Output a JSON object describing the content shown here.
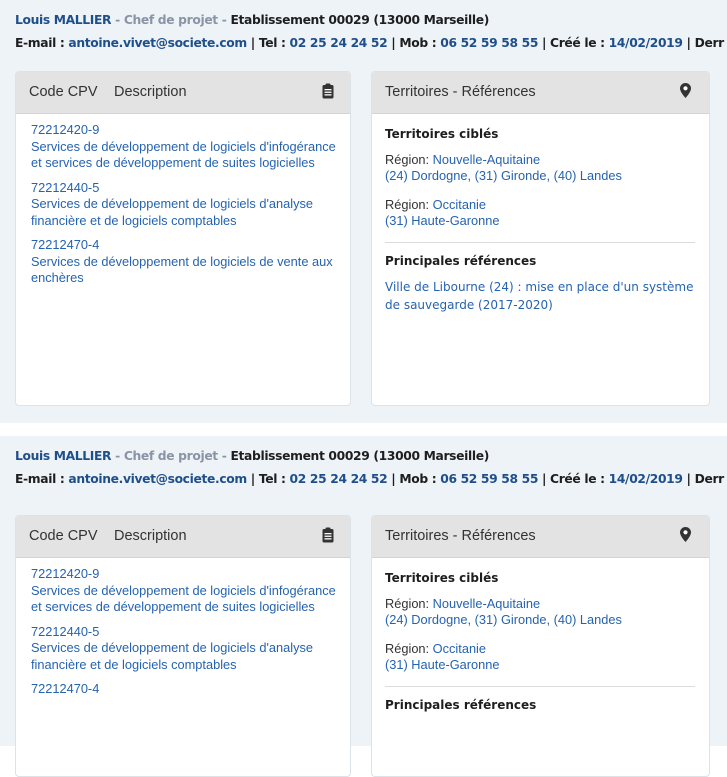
{
  "blocks": [
    {
      "contact": {
        "name": "Louis MALLIER",
        "role": "Chef de projet",
        "etablissement": "Etablissement 00029 (13000 Marseille)",
        "email_label": "E-mail :",
        "email": "antoine.vivet@societe.com",
        "tel_label": "Tel :",
        "tel": "02 25 24 24 52",
        "mob_label": "Mob :",
        "mob": "06 52 59 58 55",
        "cree_label": "Créé le :",
        "cree": "14/02/2019",
        "trailing": "Derr"
      },
      "cpv_card": {
        "col1": "Code CPV",
        "col2": "Description",
        "items": [
          {
            "code": "72212420-9",
            "desc": "Services de développement de logiciels d'infogérance et services de développement de suites logicielles"
          },
          {
            "code": "72212440-5",
            "desc": "Services de développement de logiciels d'analyse financière et de logiciels comptables"
          },
          {
            "code": "72212470-4",
            "desc": "Services de développement de logiciels de vente aux enchères"
          }
        ]
      },
      "terr_card": {
        "title": "Territoires - Références",
        "targeted_title": "Territoires ciblés",
        "regions": [
          {
            "label": "Région:",
            "name": "Nouvelle-Aquitaine",
            "deps": "(24) Dordogne, (31) Gironde, (40) Landes"
          },
          {
            "label": "Région:",
            "name": "Occitanie",
            "deps": "(31) Haute-Garonne"
          }
        ],
        "refs_title": "Principales références",
        "refs": [
          "Ville de Libourne (24) : mise en place d'un système de sauvegarde (2017-2020)"
        ]
      }
    },
    {
      "contact": {
        "name": "Louis MALLIER",
        "role": "Chef de projet",
        "etablissement": "Etablissement 00029 (13000 Marseille)",
        "email_label": "E-mail :",
        "email": "antoine.vivet@societe.com",
        "tel_label": "Tel :",
        "tel": "02 25 24 24 52",
        "mob_label": "Mob :",
        "mob": "06 52 59 58 55",
        "cree_label": "Créé le :",
        "cree": "14/02/2019",
        "trailing": "Derr"
      },
      "cpv_card": {
        "col1": "Code CPV",
        "col2": "Description",
        "items": [
          {
            "code": "72212420-9",
            "desc": "Services de développement de logiciels d'infogérance et services de développement de suites logicielles"
          },
          {
            "code": "72212440-5",
            "desc": "Services de développement de logiciels d'analyse financière et de logiciels comptables"
          },
          {
            "code": "72212470-4",
            "desc": ""
          }
        ]
      },
      "terr_card": {
        "title": "Territoires - Références",
        "targeted_title": "Territoires ciblés",
        "regions": [
          {
            "label": "Région:",
            "name": "Nouvelle-Aquitaine",
            "deps": "(24) Dordogne, (31) Gironde, (40) Landes"
          },
          {
            "label": "Région:",
            "name": "Occitanie",
            "deps": "(31) Haute-Garonne"
          }
        ],
        "refs_title": "Principales références",
        "refs": []
      }
    }
  ],
  "separator": " - ",
  "pipe": " | ",
  "icons": {
    "cpv": "clipboard-icon",
    "terr": "map-marker-icon"
  }
}
